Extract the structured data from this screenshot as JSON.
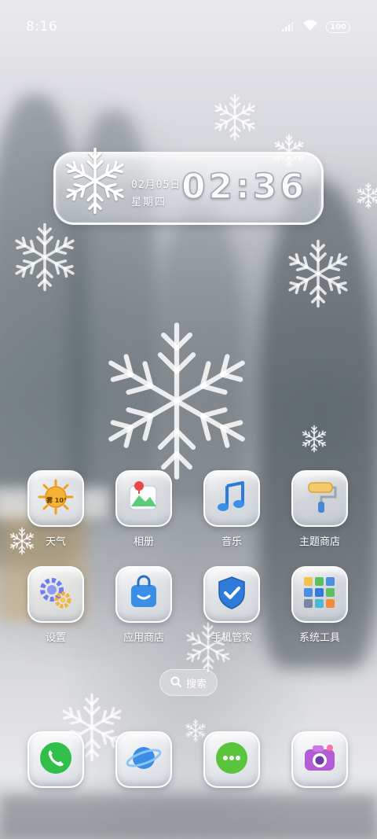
{
  "status_bar": {
    "time": "8:16",
    "battery": "100",
    "icons": [
      "signal-icon",
      "wifi-icon",
      "battery-icon"
    ]
  },
  "clock_widget": {
    "date": "02月05日",
    "weekday": "星期四",
    "time": "02:36"
  },
  "apps": [
    {
      "id": "weather",
      "label": "天气",
      "icon": "weather-icon",
      "badge": "雾 10°"
    },
    {
      "id": "gallery",
      "label": "相册",
      "icon": "gallery-icon"
    },
    {
      "id": "music",
      "label": "音乐",
      "icon": "music-icon"
    },
    {
      "id": "theme-store",
      "label": "主题商店",
      "icon": "paint-roller-icon"
    },
    {
      "id": "settings",
      "label": "设置",
      "icon": "gear-icon"
    },
    {
      "id": "app-store",
      "label": "应用商店",
      "icon": "shopping-bag-icon"
    },
    {
      "id": "phone-manager",
      "label": "手机管家",
      "icon": "shield-check-icon"
    },
    {
      "id": "system-tools",
      "label": "系统工具",
      "icon": "folder-icon"
    }
  ],
  "search": {
    "label": "搜索",
    "icon": "search-icon"
  },
  "dock": [
    {
      "id": "phone",
      "icon": "phone-icon"
    },
    {
      "id": "browser",
      "icon": "planet-icon"
    },
    {
      "id": "messages",
      "icon": "message-icon"
    },
    {
      "id": "camera",
      "icon": "camera-icon"
    }
  ],
  "colors": {
    "phone_green": "#2fbf4a",
    "message_green": "#5ac43c",
    "browser_blue": "#3a8ee6",
    "camera_purple": "#b45bd6",
    "shield_blue": "#2f7bd9"
  }
}
